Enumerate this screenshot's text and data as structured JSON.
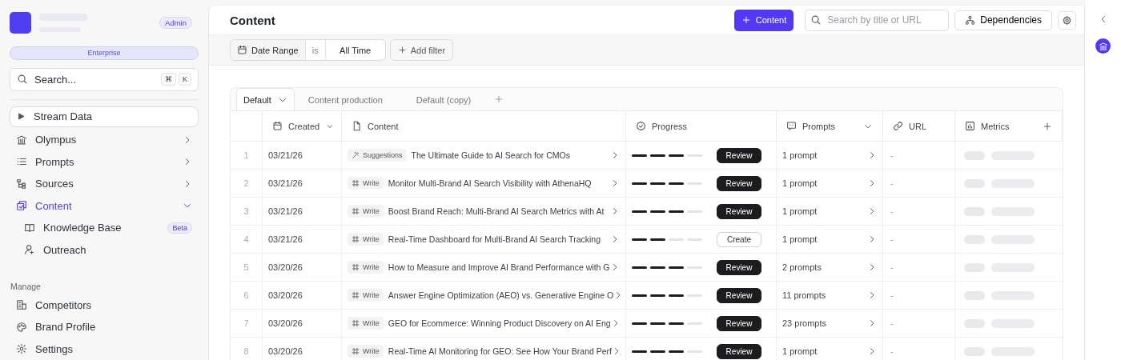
{
  "sidebar": {
    "role_badge": "Admin",
    "plan": "Enterprise",
    "search": {
      "placeholder": "Search...",
      "keys": [
        "⌘",
        "K"
      ]
    },
    "items": [
      {
        "kind": "stream",
        "label": "Stream Data",
        "selected": false
      },
      {
        "kind": "nav",
        "label": "Olympus",
        "selected": false,
        "expanded": false
      },
      {
        "kind": "nav",
        "label": "Prompts",
        "selected": false,
        "expanded": false
      },
      {
        "kind": "nav",
        "label": "Sources",
        "selected": false,
        "expanded": false
      },
      {
        "kind": "nav",
        "label": "Content",
        "selected": true,
        "expanded": true,
        "children": [
          {
            "label": "Knowledge Base",
            "badge": "Beta"
          },
          {
            "label": "Outreach"
          }
        ]
      }
    ],
    "section_title": "Manage",
    "section_items": [
      {
        "label": "Competitors"
      },
      {
        "label": "Brand Profile"
      },
      {
        "label": "Settings"
      }
    ]
  },
  "header": {
    "title": "Content",
    "new_button": "Content",
    "search": {
      "placeholder": "Search by title or URL"
    },
    "dependencies_button": "Dependencies"
  },
  "filters": {
    "field": "Date Range",
    "operator": "is",
    "value": "All Time",
    "add_button": "Add filter"
  },
  "view_tabs": [
    {
      "label": "Default",
      "selected": true
    },
    {
      "label": "Content production",
      "selected": false
    },
    {
      "label": "Default (copy)",
      "selected": false
    }
  ],
  "table": {
    "columns": [
      "Created",
      "Content",
      "Progress",
      "Prompts",
      "URL",
      "Metrics"
    ],
    "rows": [
      {
        "number": "1",
        "created": "03/21/26",
        "type": {
          "kind": "suggestions",
          "label": "Suggestions"
        },
        "title": "The Ultimate Guide to AI Search for CMOs",
        "level": 0.75,
        "action": {
          "kind": "review",
          "label": "Review"
        },
        "prompts": "1 prompt",
        "url": "-"
      },
      {
        "number": "2",
        "created": "03/21/26",
        "type": {
          "kind": "write",
          "label": "Write"
        },
        "title": "Monitor Multi-Brand AI Search Visibility with AthenaHQ",
        "level": 0.75,
        "action": {
          "kind": "review",
          "label": "Review"
        },
        "prompts": "1 prompt",
        "url": "-"
      },
      {
        "number": "3",
        "created": "03/21/26",
        "type": {
          "kind": "write",
          "label": "Write"
        },
        "title": "Boost Brand Reach: Multi-Brand AI Search Metrics with At",
        "level": 0.75,
        "action": {
          "kind": "review",
          "label": "Review"
        },
        "prompts": "1 prompt",
        "url": "-"
      },
      {
        "number": "4",
        "created": "03/21/26",
        "type": {
          "kind": "write",
          "label": "Write"
        },
        "title": "Real-Time Dashboard for Multi-Brand AI Search Tracking",
        "level": 0.5,
        "action": {
          "kind": "create",
          "label": "Create"
        },
        "prompts": "1 prompt",
        "url": "-"
      },
      {
        "number": "5",
        "created": "03/20/26",
        "type": {
          "kind": "write",
          "label": "Write"
        },
        "title": "How to Measure and Improve AI Brand Performance with G",
        "level": 0.75,
        "action": {
          "kind": "review",
          "label": "Review"
        },
        "prompts": "2 prompts",
        "url": "-"
      },
      {
        "number": "6",
        "created": "03/20/26",
        "type": {
          "kind": "write",
          "label": "Write"
        },
        "title": "Answer Engine Optimization (AEO) vs. Generative Engine O",
        "level": 0.75,
        "action": {
          "kind": "review",
          "label": "Review"
        },
        "prompts": "11 prompts",
        "url": "-"
      },
      {
        "number": "7",
        "created": "03/20/26",
        "type": {
          "kind": "write",
          "label": "Write"
        },
        "title": "GEO for Ecommerce: Winning Product Discovery on AI Eng",
        "level": 0.75,
        "action": {
          "kind": "review",
          "label": "Review"
        },
        "prompts": "23 prompts",
        "url": "-"
      },
      {
        "number": "8",
        "created": "03/20/26",
        "type": {
          "kind": "write",
          "label": "Write"
        },
        "title": "Real-Time AI Monitoring for GEO: See How Your Brand Perf",
        "level": 0.75,
        "action": {
          "kind": "review",
          "label": "Review"
        },
        "prompts": "1 prompt",
        "url": "-"
      }
    ]
  }
}
